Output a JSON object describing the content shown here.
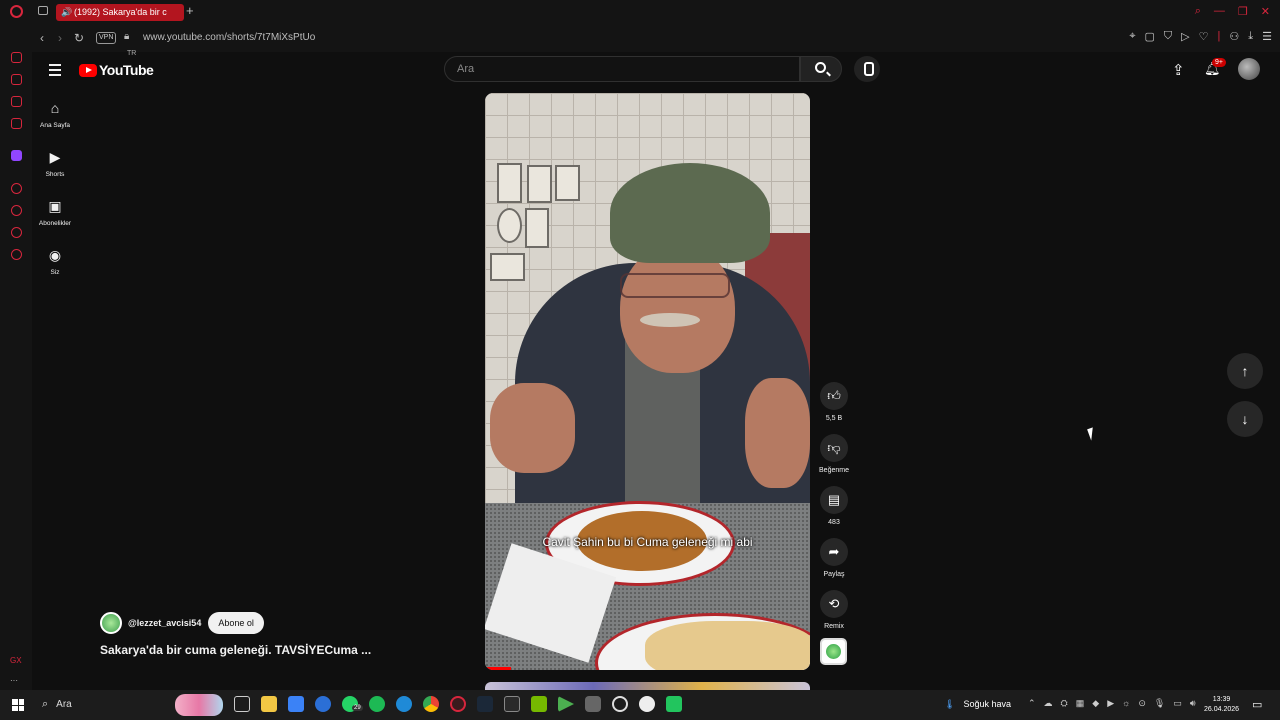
{
  "browser": {
    "tab_title": "(1992) Sakarya'da bir c",
    "url": "www.youtube.com/shorts/7t7MiXsPtUo",
    "vpn_label": "VPN",
    "accent_color": "#d7263d"
  },
  "header": {
    "logo_text": "YouTube",
    "region": "TR",
    "search_placeholder": "Ara",
    "notifications_badge": "9+"
  },
  "sidebar": {
    "items": [
      {
        "label": "Ana Sayfa",
        "icon": "home-icon"
      },
      {
        "label": "Shorts",
        "icon": "shorts-icon"
      },
      {
        "label": "Abonelikler",
        "icon": "subscriptions-icon"
      },
      {
        "label": "Siz",
        "icon": "you-icon"
      }
    ]
  },
  "short": {
    "caption": "Cavit Şahin bu bi Cuma geleneği mi abi",
    "channel": "@lezzet_avcisi54",
    "subscribe_label": "Abone ol",
    "title": "Sakarya'da bir cuma geleneği. TAVSİYECuma ...",
    "progress": 0.08
  },
  "actions": {
    "like_count": "5,5 B",
    "dislike_label": "Beğenme",
    "comment_count": "483",
    "share_label": "Paylaş",
    "remix_label": "Remix"
  },
  "taskbar": {
    "search_label": "Ara",
    "whatsapp_badge": "29",
    "weather": "Soğuk hava",
    "time": "13:39",
    "date": "26.04.2026"
  }
}
